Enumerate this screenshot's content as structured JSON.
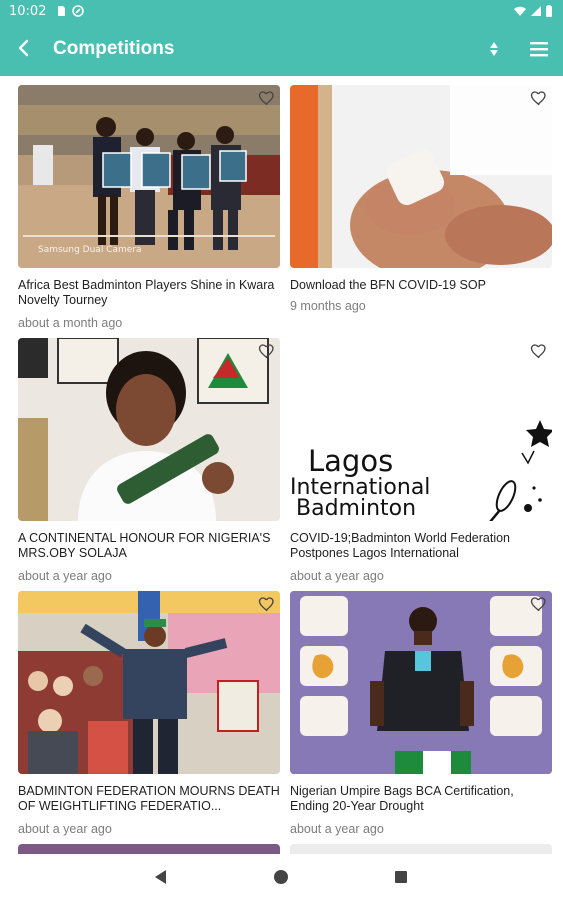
{
  "status": {
    "time": "10:02"
  },
  "appbar": {
    "title": "Competitions"
  },
  "colors": {
    "primary": "#49bfb1",
    "title_text": "#1f1f1f",
    "meta_text": "#7d7d7d"
  },
  "cards": [
    {
      "title": "Africa Best Badminton Players Shine in Kwara Novelty Tourney",
      "time": "about a month ago",
      "watermark": "Samsung Dual Camera"
    },
    {
      "title": "Download the BFN COVID-19 SOP",
      "time": "9 months ago"
    },
    {
      "title": "A CONTINENTAL HONOUR FOR NIGERIA'S MRS.OBY SOLAJA",
      "time": "about a year ago"
    },
    {
      "title": "COVID-19;Badminton World Federation Postpones Lagos International",
      "time": "about a year ago",
      "poster": {
        "line1": "Lagos",
        "line2": "International",
        "line3": "Badminton"
      }
    },
    {
      "title": "BADMINTON FEDERATION MOURNS DEATH OF WEIGHTLIFTING FEDERATIO...",
      "time": "about a year ago"
    },
    {
      "title": "Nigerian Umpire Bags BCA Certification, Ending 20-Year Drought",
      "time": "about a year ago"
    }
  ],
  "icons": {
    "back": "arrow-back-icon",
    "sort": "sort-icon",
    "menu": "menu-icon",
    "favorite": "heart-outline-icon",
    "nav_back": "triangle-back-icon",
    "nav_home": "circle-home-icon",
    "nav_recents": "square-recents-icon"
  }
}
